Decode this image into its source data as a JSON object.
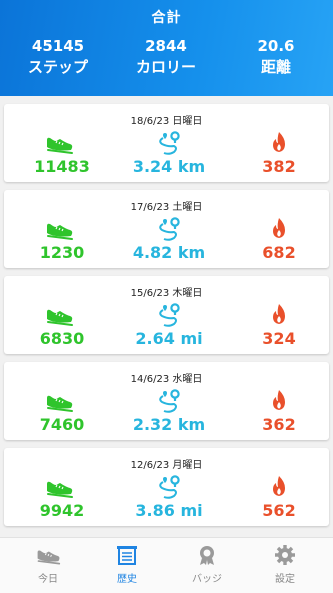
{
  "summary": {
    "title": "合計",
    "steps_value": "45145",
    "steps_label": "ステップ",
    "calories_value": "2844",
    "calories_label": "カロリー",
    "distance_value": "20.6",
    "distance_label": "距離"
  },
  "entries": [
    {
      "date": "18/6/23  日曜日",
      "steps": "11483",
      "distance": "3.24 km",
      "calories": "382"
    },
    {
      "date": "17/6/23  土曜日",
      "steps": "1230",
      "distance": "4.82 km",
      "calories": "682"
    },
    {
      "date": "15/6/23  木曜日",
      "steps": "6830",
      "distance": "2.64 mi",
      "calories": "324"
    },
    {
      "date": "14/6/23  水曜日",
      "steps": "7460",
      "distance": "2.32 km",
      "calories": "362"
    },
    {
      "date": "12/6/23  月曜日",
      "steps": "9942",
      "distance": "3.86 mi",
      "calories": "562"
    }
  ],
  "tabs": {
    "today": "今日",
    "history": "歴史",
    "badge": "バッジ",
    "settings": "設定"
  },
  "colors": {
    "header": "#1590ec",
    "steps": "#2fc42c",
    "distance": "#27b5de",
    "calories": "#e9502b",
    "active_tab": "#1f84e2"
  },
  "icons": {
    "steps": "shoe-icon",
    "distance": "route-pin-icon",
    "calories": "flame-icon",
    "tab_today": "shoe-icon",
    "tab_history": "calendar-icon",
    "tab_badge": "medal-icon",
    "tab_settings": "gear-icon"
  }
}
